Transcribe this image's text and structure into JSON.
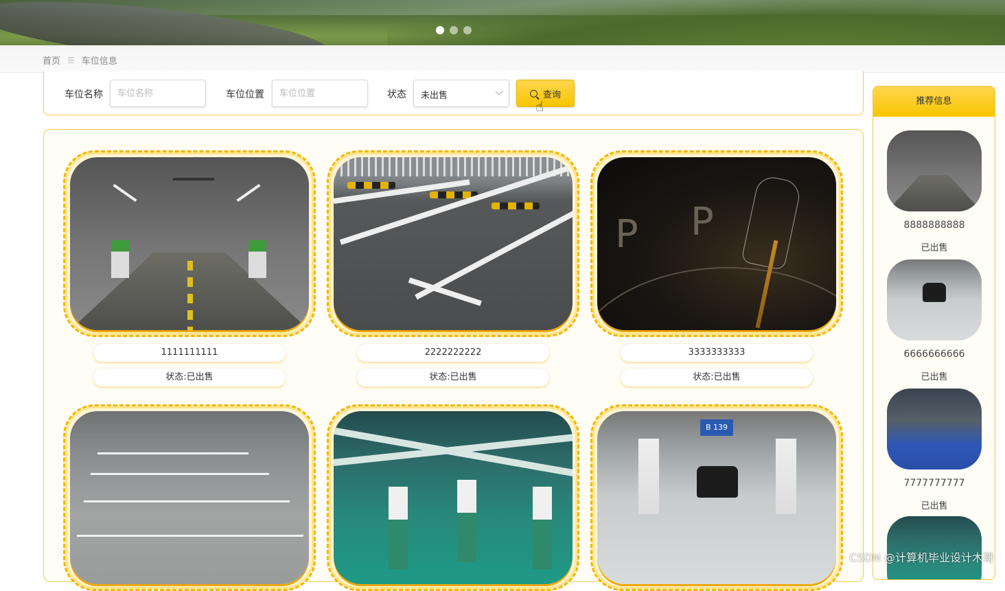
{
  "carousel": {
    "dots": 3,
    "active": 0
  },
  "breadcrumb": {
    "home": "首页",
    "separator": "☰",
    "current": "车位信息"
  },
  "search": {
    "name_label": "车位名称",
    "name_placeholder": "车位名称",
    "location_label": "车位位置",
    "location_placeholder": "车位位置",
    "status_label": "状态",
    "status_value": "未出售",
    "query_button": "查询"
  },
  "spots": [
    {
      "name": "1111111111",
      "status": "状态:已出售",
      "image": "underground-garage-photo"
    },
    {
      "name": "2222222222",
      "status": "状态:已出售",
      "image": "outdoor-lot-photo"
    },
    {
      "name": "3333333333",
      "status": "状态:已出售",
      "image": "parking-graphic-photo"
    },
    {
      "name": "",
      "status": "",
      "image": "outdoor-lines-photo"
    },
    {
      "name": "",
      "status": "",
      "image": "green-garage-photo"
    },
    {
      "name": "",
      "status": "",
      "image": "garage-b139-photo"
    }
  ],
  "sidebar": {
    "title": "推荐信息",
    "items": [
      {
        "name": "8888888888",
        "status": "已出售"
      },
      {
        "name": "6666666666",
        "status": "已出售"
      },
      {
        "name": "7777777777",
        "status": "已出售"
      }
    ]
  },
  "sign_text": "B 139",
  "watermark": "CSDN @计算机毕业设计木哥",
  "colors": {
    "accent": "#f7c600",
    "border": "#f2c94c"
  }
}
